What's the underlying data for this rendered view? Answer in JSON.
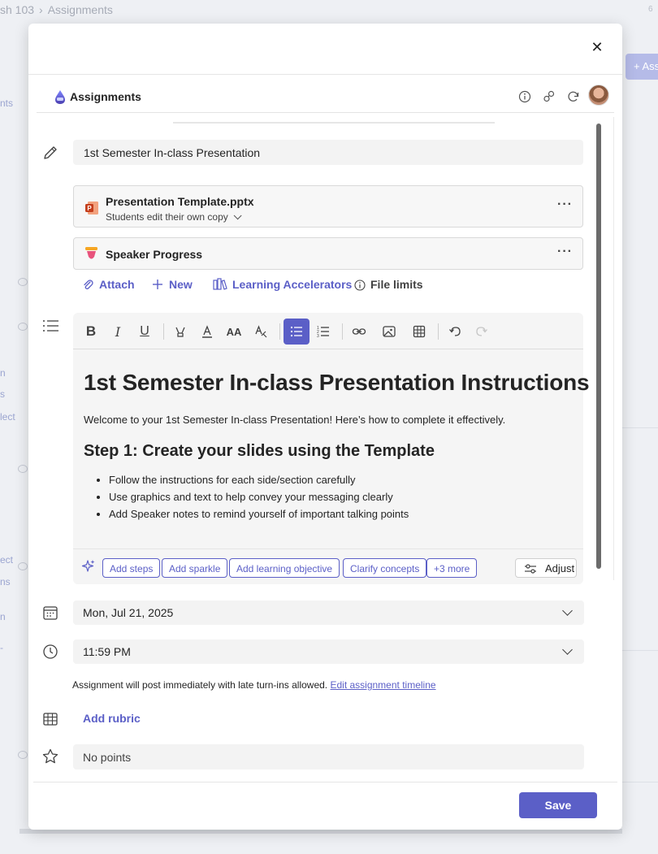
{
  "background": {
    "breadcrumb": {
      "course": "sh 103",
      "separator": "›",
      "page": "Assignments"
    },
    "top_right_fragment": "6",
    "assign_button_label": "+ Assi",
    "left_fragments": [
      "nts",
      "n",
      "s",
      "lect",
      "ect",
      "ns",
      "n",
      "-"
    ]
  },
  "modal": {
    "close_icon": "close-icon",
    "app_header": {
      "title": "Assignments",
      "icons": [
        "info-icon",
        "link-icon",
        "refresh-icon",
        "avatar"
      ]
    },
    "title_field": {
      "value": "1st Semester In-class Presentation"
    },
    "attachments": [
      {
        "name": "Presentation Template.pptx",
        "subtitle": "Students edit their own copy",
        "icon": "powerpoint-icon",
        "more": "···"
      },
      {
        "name": "Speaker Progress",
        "icon": "speaker-progress-icon",
        "more": "···"
      }
    ],
    "actions": {
      "attach": "Attach",
      "new": "New",
      "learning_accelerators": "Learning Accelerators",
      "file_limits": "File limits"
    },
    "editor": {
      "toolbar": [
        "bold",
        "italic",
        "underline",
        "highlight",
        "font-color",
        "font-size",
        "text-format",
        "bulleted-list",
        "numbered-list",
        "link",
        "image",
        "table",
        "undo",
        "redo"
      ],
      "active_tool": "bulleted-list",
      "heading": "1st Semester In-class Presentation Instructions",
      "intro": "Welcome to your 1st Semester In-class Presentation! Here’s how to complete it effectively.",
      "step_heading": "Step 1: Create your slides using the Template",
      "bullets": [
        "Follow the instructions for each side/section carefully",
        "Use graphics and text to help convey your messaging clearly",
        "Add Speaker notes to remind yourself of important talking points"
      ],
      "ai_chips": [
        "Add steps",
        "Add sparkle",
        "Add learning objective",
        "Clarify concepts",
        "+3 more"
      ],
      "adjust_label": "Adjust"
    },
    "due_date": "Mon, Jul 21, 2025",
    "due_time": "11:59 PM",
    "timeline_note": "Assignment will post immediately with late turn-ins allowed.",
    "timeline_link": "Edit assignment timeline",
    "add_rubric": "Add rubric",
    "points": "No points",
    "save_label": "Save"
  },
  "colors": {
    "accent": "#5b5fc7",
    "field_bg": "#f3f3f3",
    "text": "#242424"
  }
}
